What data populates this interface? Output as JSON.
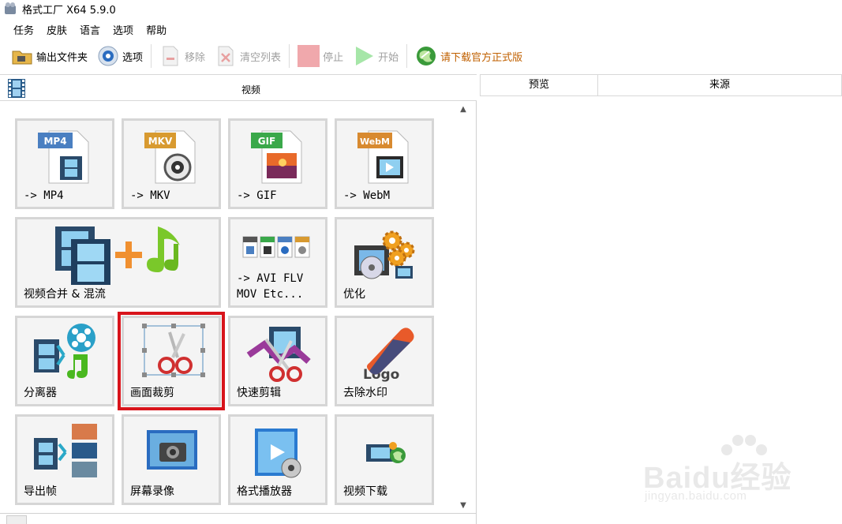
{
  "window": {
    "title": "格式工厂 X64 5.9.0"
  },
  "menu": [
    "任务",
    "皮肤",
    "语言",
    "选项",
    "帮助"
  ],
  "toolbar": {
    "output_folder": "输出文件夹",
    "options": "选项",
    "remove": "移除",
    "clear_list": "清空列表",
    "stop": "停止",
    "start": "开始",
    "download_official": "请下载官方正式版"
  },
  "category": {
    "title": "视频"
  },
  "tiles": [
    {
      "label": "-> MP4",
      "badge": "MP4",
      "badge_color": "#4a7fc1"
    },
    {
      "label": "-> MKV",
      "badge": "MKV",
      "badge_color": "#d89a30"
    },
    {
      "label": "-> GIF",
      "badge": "GIF",
      "badge_color": "#3aa84a"
    },
    {
      "label": "-> WebM",
      "badge": "WebM",
      "badge_color": "#d88a30"
    },
    {
      "label": "视频合并 & 混流"
    },
    {
      "label": "-> AVI FLV\nMOV Etc..."
    },
    {
      "label": "优化"
    },
    {
      "label": "分离器"
    },
    {
      "label": "画面裁剪"
    },
    {
      "label": "快速剪辑"
    },
    {
      "label": "去除水印",
      "logo_text": "Logo"
    },
    {
      "label": "导出帧"
    },
    {
      "label": "屏幕录像"
    },
    {
      "label": "格式播放器"
    },
    {
      "label": "视频下载"
    }
  ],
  "right_panel": {
    "columns": [
      "预览",
      "来源"
    ]
  },
  "watermark": {
    "text": "Baidu经验",
    "sub": "jingyan.baidu.com"
  },
  "colors": {
    "highlight": "#d8141b",
    "tile_bg": "#f4f4f4",
    "tile_border": "#d6d6d6",
    "link": "#c06000"
  }
}
